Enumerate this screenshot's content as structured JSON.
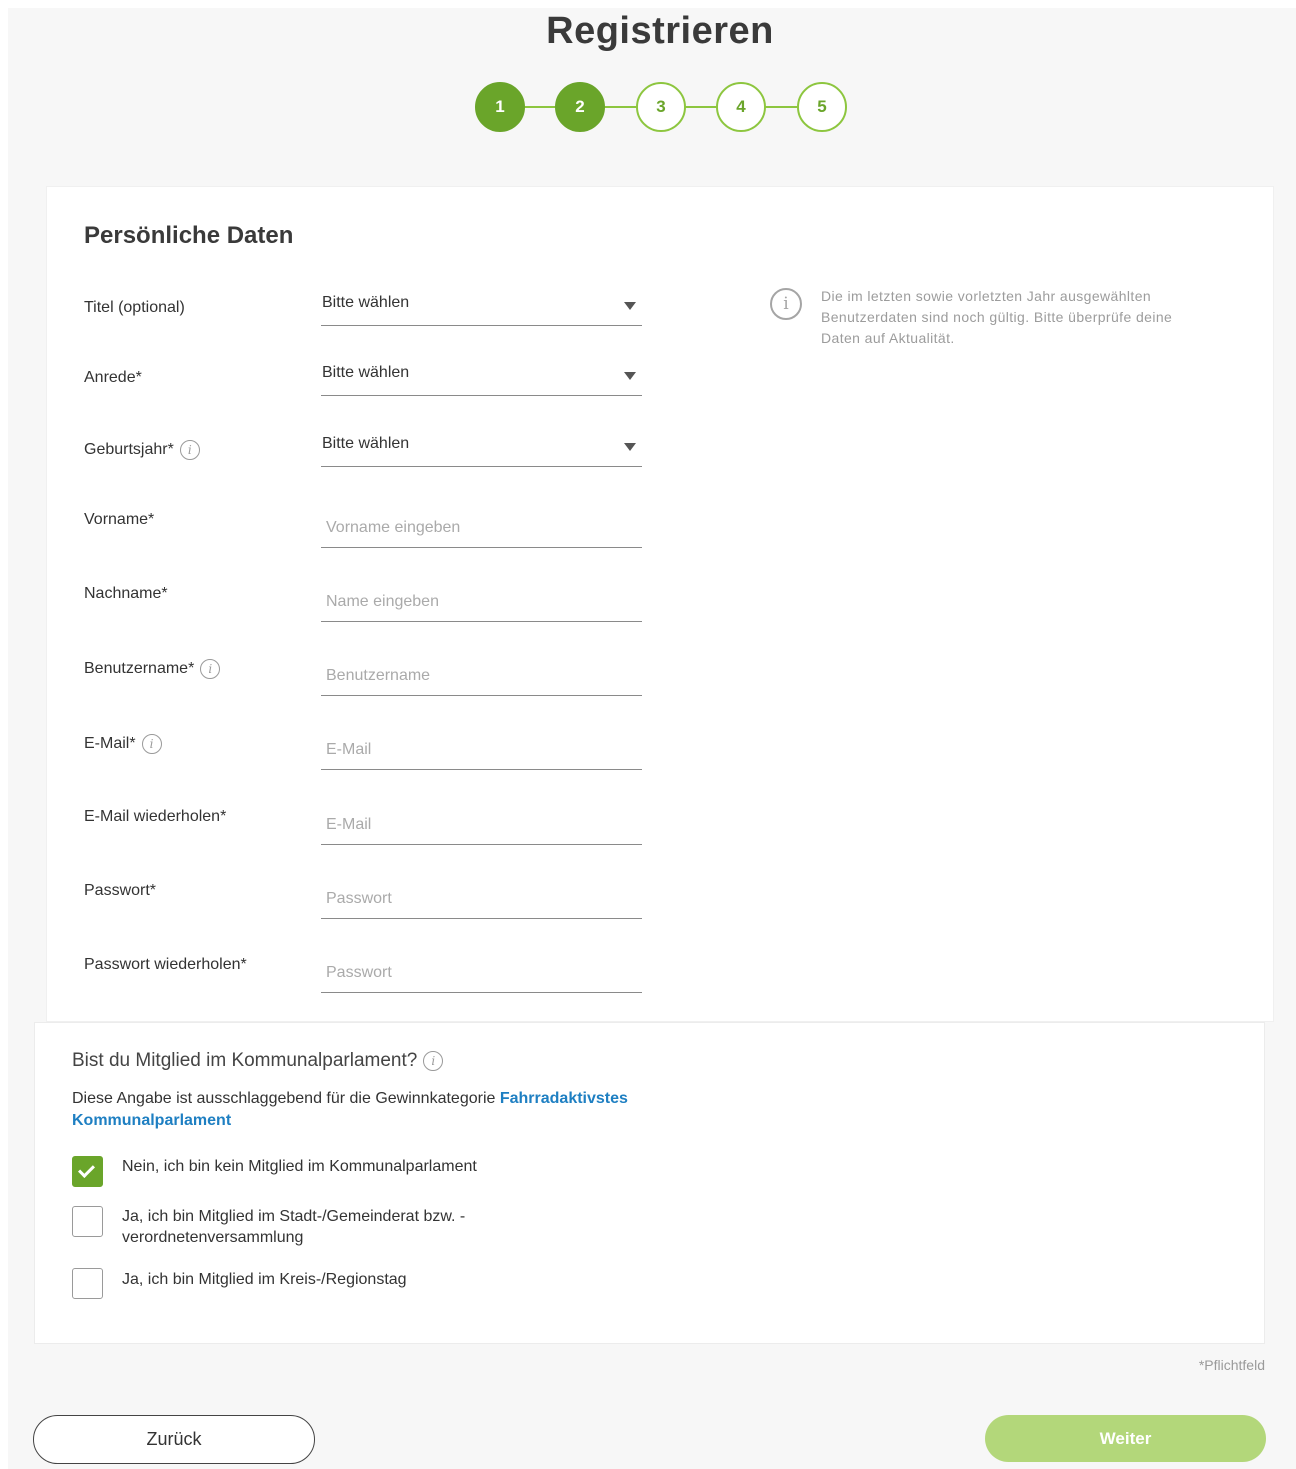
{
  "page": {
    "title": "Registrieren",
    "steps": [
      "1",
      "2",
      "3",
      "4",
      "5"
    ],
    "current_step": 2
  },
  "personal": {
    "heading": "Persönliche Daten",
    "hint_icon": "info-icon",
    "hint": "Die im letzten sowie vorletzten Jahr ausgewählten Benutzerdaten sind noch gültig. Bitte überprüfe deine Daten auf Aktualität.",
    "fields": {
      "titel": {
        "label": "Titel (optional)",
        "value": "Bitte wählen"
      },
      "anrede": {
        "label": "Anrede*",
        "value": "Bitte wählen"
      },
      "geburtsjahr": {
        "label": "Geburtsjahr*",
        "value": "Bitte wählen"
      },
      "vorname": {
        "label": "Vorname*",
        "placeholder": "Vorname eingeben",
        "value": ""
      },
      "nachname": {
        "label": "Nachname*",
        "placeholder": "Name eingeben",
        "value": ""
      },
      "benutzername": {
        "label": "Benutzername*",
        "placeholder": "Benutzername",
        "value": ""
      },
      "email": {
        "label": "E-Mail*",
        "placeholder": "E-Mail",
        "value": ""
      },
      "email_repeat": {
        "label": "E-Mail wiederholen*",
        "placeholder": "E-Mail",
        "value": ""
      },
      "passwort": {
        "label": "Passwort*",
        "placeholder": "Passwort",
        "value": ""
      },
      "passwort_repeat": {
        "label": "Passwort wiederholen*",
        "placeholder": "Passwort",
        "value": ""
      }
    }
  },
  "membership": {
    "question": "Bist du Mitglied im Kommunalparlament?",
    "description": "Diese Angabe ist ausschlaggebend für die Gewinnkategorie",
    "link": "Fahrradaktivstes Kommunalparlament",
    "options": [
      {
        "label": "Nein, ich bin kein Mitglied im Kommunalparlament",
        "checked": true
      },
      {
        "label": "Ja, ich bin Mitglied im Stadt-/Gemeinderat bzw. -verordnetenversammlung",
        "checked": false
      },
      {
        "label": "Ja, ich bin Mitglied im Kreis-/Regionstag",
        "checked": false
      }
    ]
  },
  "footer": {
    "required_note": "*Pflichtfeld",
    "back_label": "Zurück",
    "next_label": "Weiter"
  },
  "colors": {
    "accent": "#6aa52a",
    "accent_light": "#b3d77a",
    "link": "#1e7fc2"
  }
}
